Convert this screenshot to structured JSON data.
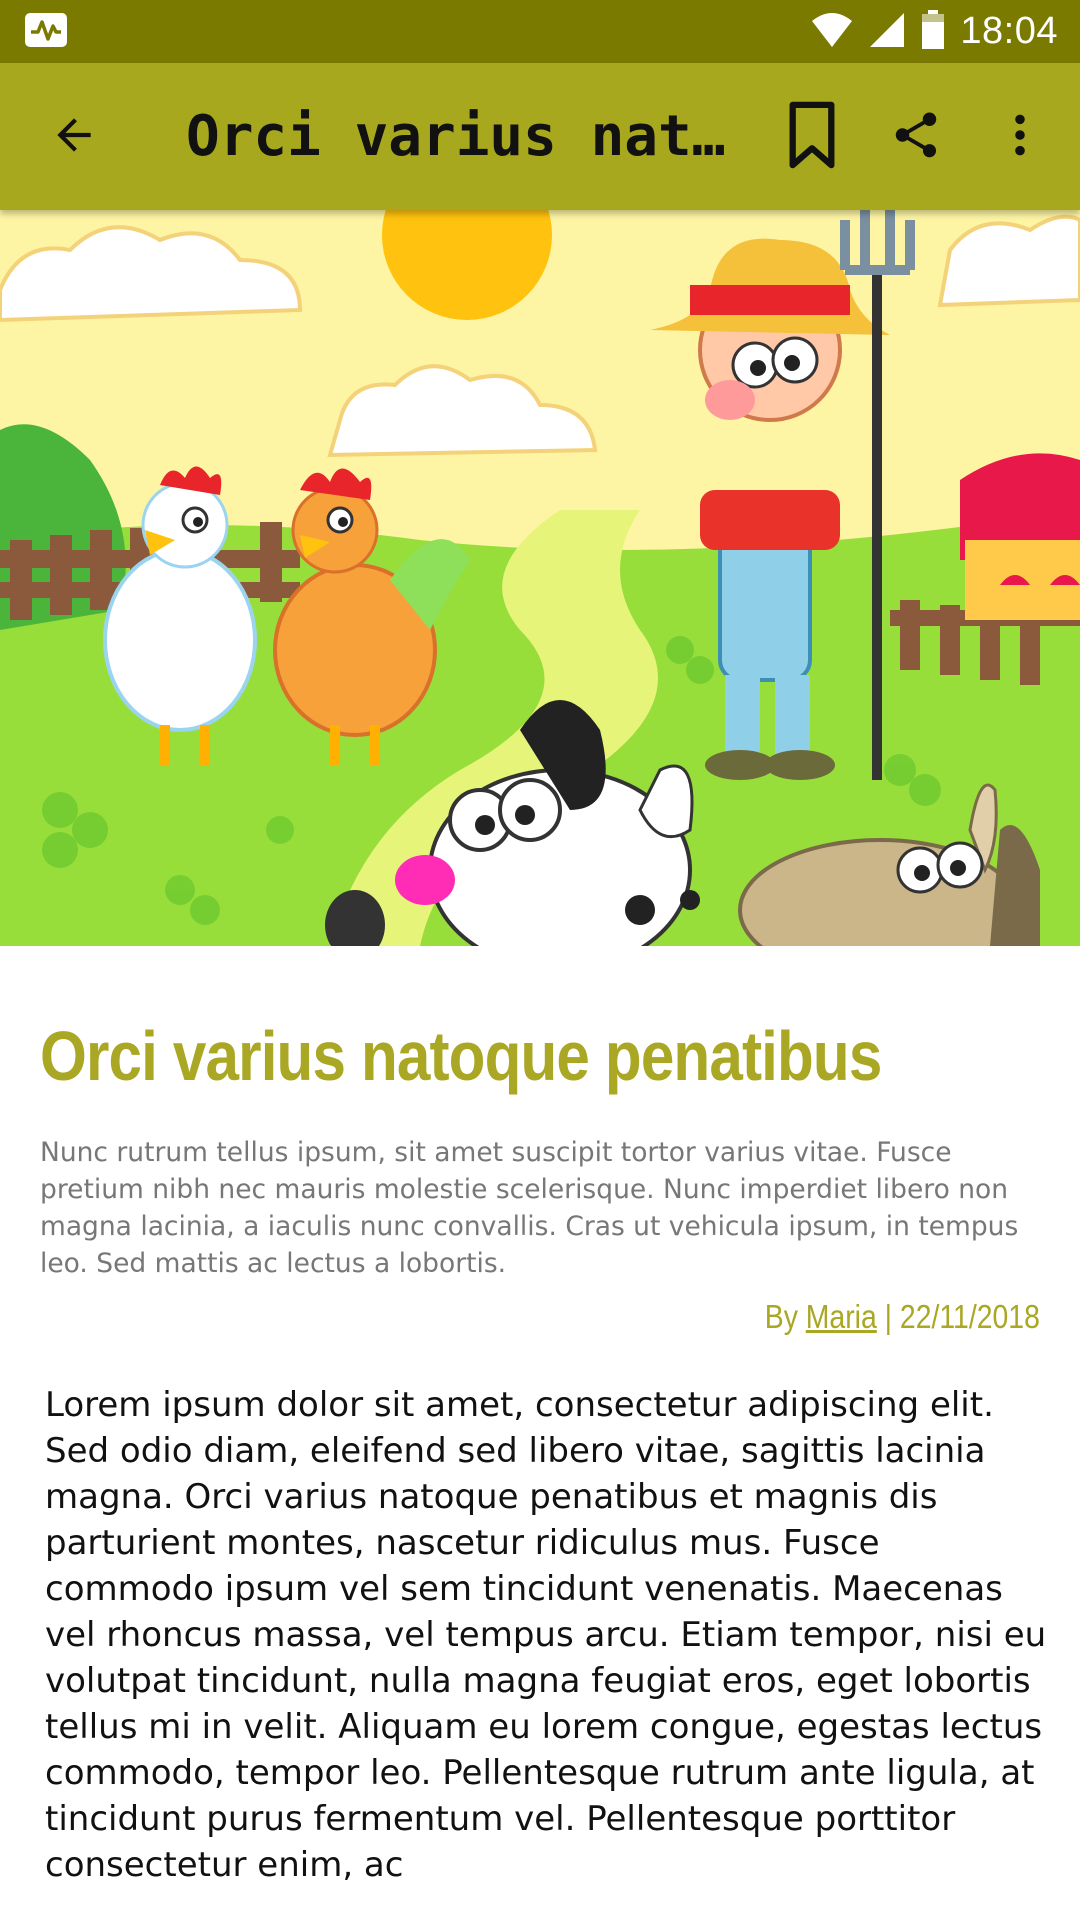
{
  "status_bar": {
    "time": "18:04",
    "icons": [
      "activity-icon",
      "wifi-icon",
      "signal-icon",
      "battery-icon"
    ]
  },
  "app_bar": {
    "title": "Orci varius natoque penatibus",
    "icons": [
      "back-arrow-icon",
      "bookmark-icon",
      "share-icon",
      "more-vert-icon"
    ],
    "background": "#a8a81f"
  },
  "hero": {
    "description": "cartoon farm illustration"
  },
  "article": {
    "headline": "Orci varius natoque penatibus",
    "summary": "Nunc rutrum tellus ipsum, sit amet suscipit tortor varius vitae. Fusce pretium nibh nec mauris molestie scelerisque. Nunc imperdiet libero non magna lacinia, a iaculis nunc convallis. Cras ut vehicula ipsum, in tempus leo. Sed mattis ac lectus a lobortis.",
    "byline_prefix": "By",
    "author": "Maria",
    "byline_separator": "|",
    "date": "22/11/2018",
    "body": "Lorem ipsum dolor sit amet, consectetur adipiscing elit. Sed odio diam, eleifend sed libero vitae, sagittis lacinia magna. Orci varius natoque penatibus et magnis dis parturient montes, nascetur ridiculus mus. Fusce commodo ipsum vel sem tincidunt venenatis. Maecenas vel rhoncus massa, vel tempus arcu. Etiam tempor, nisi eu volutpat tincidunt, nulla magna feugiat eros, eget lobortis tellus mi in velit. Aliquam eu lorem congue, egestas lectus commodo, tempor leo. Pellentesque rutrum ante ligula, at tincidunt purus fermentum vel. Pellentesque porttitor consectetur enim, ac",
    "accent_color": "#a9a724"
  }
}
